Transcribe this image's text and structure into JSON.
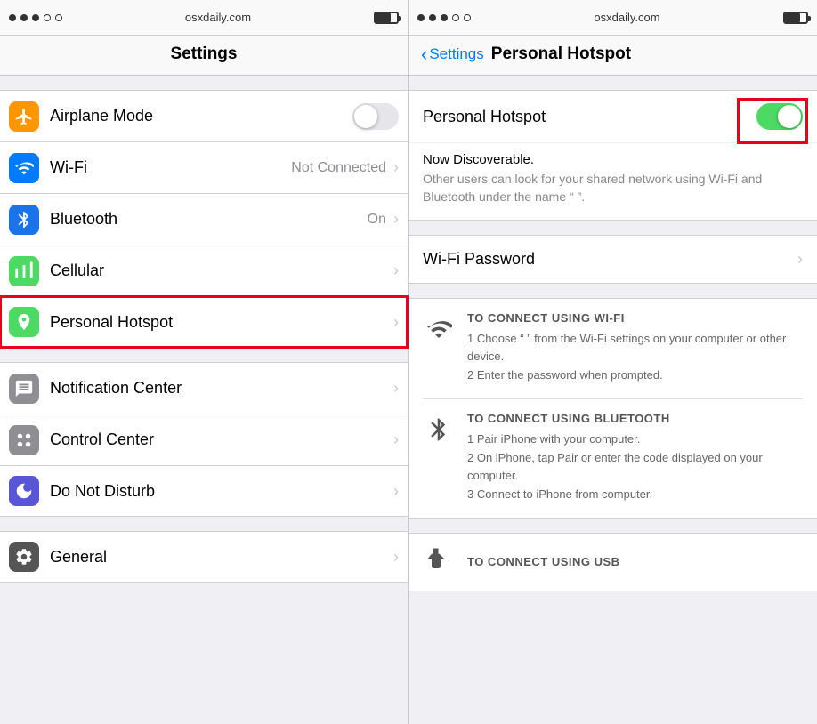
{
  "left": {
    "statusBar": {
      "url": "osxdaily.com",
      "dots": [
        true,
        true,
        true,
        false,
        false
      ]
    },
    "title": "Settings",
    "rows": [
      {
        "id": "airplane",
        "label": "Airplane Mode",
        "iconClass": "icon-orange",
        "iconType": "airplane",
        "hasToggle": true,
        "toggleOn": false,
        "hasChevron": false,
        "value": ""
      },
      {
        "id": "wifi",
        "label": "Wi-Fi",
        "iconClass": "icon-blue",
        "iconType": "wifi",
        "hasToggle": false,
        "hasChevron": true,
        "value": "Not Connected"
      },
      {
        "id": "bluetooth",
        "label": "Bluetooth",
        "iconClass": "icon-bluetooth",
        "iconType": "bluetooth",
        "hasToggle": false,
        "hasChevron": true,
        "value": "On"
      },
      {
        "id": "cellular",
        "label": "Cellular",
        "iconClass": "icon-cellular",
        "iconType": "cellular",
        "hasToggle": false,
        "hasChevron": true,
        "value": ""
      },
      {
        "id": "hotspot",
        "label": "Personal Hotspot",
        "iconClass": "icon-hotspot",
        "iconType": "hotspot",
        "hasToggle": false,
        "hasChevron": true,
        "value": "",
        "highlighted": true
      }
    ],
    "rows2": [
      {
        "id": "notification",
        "label": "Notification Center",
        "iconClass": "icon-gray",
        "iconType": "notification",
        "hasChevron": true
      },
      {
        "id": "controlcenter",
        "label": "Control Center",
        "iconClass": "icon-gray2",
        "iconType": "controlcenter",
        "hasChevron": true
      },
      {
        "id": "donotdisturb",
        "label": "Do Not Disturb",
        "iconClass": "icon-purple",
        "iconType": "donotdisturb",
        "hasChevron": true
      }
    ],
    "rows3": [
      {
        "id": "general",
        "label": "General",
        "iconClass": "icon-darkgray",
        "iconType": "gear",
        "hasChevron": true
      }
    ]
  },
  "right": {
    "statusBar": {
      "url": "osxdaily.com"
    },
    "backLabel": "Settings",
    "title": "Personal Hotspot",
    "hotspotLabel": "Personal Hotspot",
    "hotspotOn": true,
    "discoverableTitle": "Now Discoverable.",
    "discoverableDesc": "Other users can look for your shared network using Wi-Fi and Bluetooth under the name “                     ”.",
    "wifiPasswordLabel": "Wi-Fi Password",
    "instructions": [
      {
        "type": "wifi",
        "title": "TO CONNECT USING WI-FI",
        "steps": [
          "1 Choose “                     ” from the Wi-Fi settings on your computer or other device.",
          "2 Enter the password when prompted."
        ]
      },
      {
        "type": "bluetooth",
        "title": "TO CONNECT USING BLUETOOTH",
        "steps": [
          "1 Pair iPhone with your computer.",
          "2 On iPhone, tap Pair or enter the code displayed on your computer.",
          "3 Connect to iPhone from computer."
        ]
      }
    ],
    "usbTitle": "TO CONNECT USING USB"
  }
}
